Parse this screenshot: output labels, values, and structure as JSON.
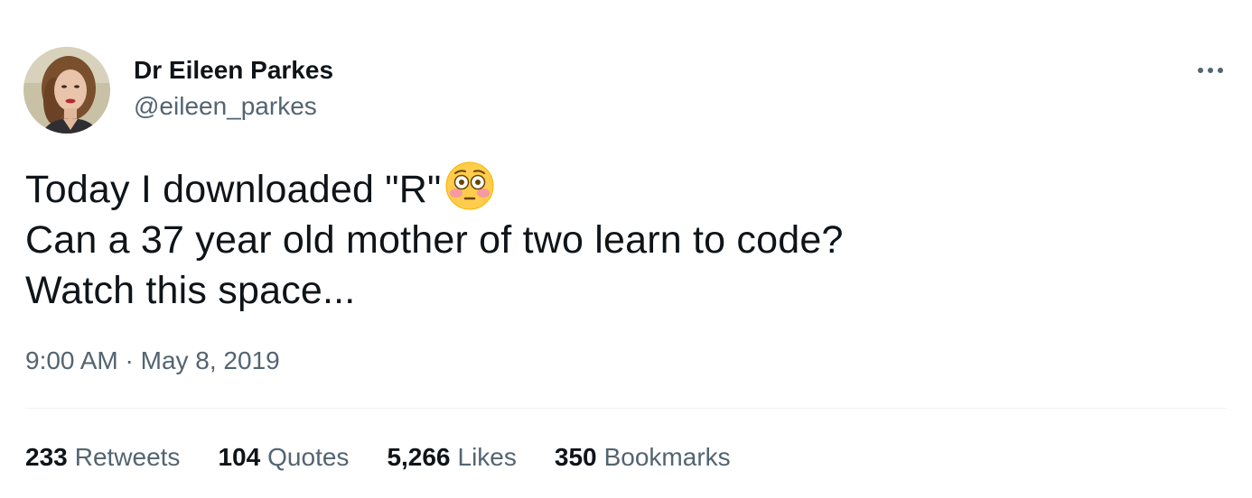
{
  "author": {
    "display_name": "Dr Eileen Parkes",
    "handle": "@eileen_parkes",
    "avatar_icon": "profile-photo"
  },
  "menu": {
    "more_icon": "more-horizontal-icon"
  },
  "tweet": {
    "lines": [
      "Today I downloaded \"R\"",
      "Can a 37 year old mother of two learn to code?",
      "Watch this space..."
    ],
    "emoji": "flushed-face-icon"
  },
  "meta": {
    "time": "9:00 AM",
    "separator": "·",
    "date": "May 8, 2019"
  },
  "stats": [
    {
      "count": "233",
      "label": "Retweets"
    },
    {
      "count": "104",
      "label": "Quotes"
    },
    {
      "count": "5,266",
      "label": "Likes"
    },
    {
      "count": "350",
      "label": "Bookmarks"
    }
  ],
  "colors": {
    "text_primary": "#0f1419",
    "text_secondary": "#536471",
    "divider": "#eff3f4"
  }
}
